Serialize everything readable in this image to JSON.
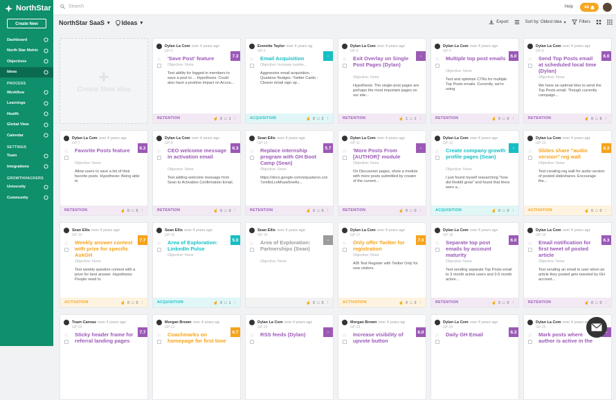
{
  "app": {
    "logo": "NorthStar",
    "create_new": "Create New"
  },
  "nav": [
    {
      "label": "Dashboard",
      "icon": "dashboard-icon",
      "active": false
    },
    {
      "label": "North Star Metric",
      "icon": "target-icon",
      "active": false
    },
    {
      "label": "Objectives",
      "icon": "flag-icon",
      "active": false
    },
    {
      "label": "Ideas",
      "icon": "lightbulb-icon",
      "active": true
    }
  ],
  "sections": {
    "process": "PROCESS",
    "settings": "SETTINGS",
    "growthhackers": "GROWTHHACKERS"
  },
  "process_items": [
    {
      "label": "Workflow"
    },
    {
      "label": "Learnings"
    },
    {
      "label": "Health"
    },
    {
      "label": "Global View"
    },
    {
      "label": "Calendar"
    }
  ],
  "settings_items": [
    {
      "label": "Team"
    },
    {
      "label": "Integrations"
    }
  ],
  "gh_items": [
    {
      "label": "University"
    },
    {
      "label": "Community"
    }
  ],
  "topbar": {
    "search_placeholder": "Search",
    "help": "Help",
    "notif_count": "44"
  },
  "header": {
    "project": "NorthStar SaaS",
    "board": "Ideas",
    "export": "Export",
    "sort": "Sort by: Oldest Idea",
    "filters": "Filters"
  },
  "create_card": {
    "text": "Create New Idea"
  },
  "colors": {
    "retention": "#9b59b6",
    "acquisition": "#16bfc4",
    "activation": "#f5a31a",
    "gray": "#9b9b9b"
  },
  "cards": [
    {
      "author": "Dylan La Com",
      "time": "over 4 years ago",
      "id": "GP-2",
      "score": "7.3",
      "title": "'Save Post' feature",
      "objective": "Objective: None",
      "desc": "Test ability for logged-in members to save a post to ... Hypothesis: Could also have a positive impact on Accou...",
      "category": "RETENTION",
      "color": "#9b59b6",
      "likes": "0",
      "comments": "1"
    },
    {
      "author": "Everette Taylor",
      "time": "over 4 years ago",
      "id": "GP-2",
      "score": "-",
      "title": "Email Acquisition",
      "objective": "Objective: Increase numbe...",
      "desc": "Aggressive email acquisition. -Qualaroo Nudges -Twitter Cards -Clearer email sign up...",
      "category": "ACQUISITION",
      "color": "#16bfc4",
      "likes": "0",
      "comments": "2"
    },
    {
      "author": "Dylan La Com",
      "time": "over 4 years ago",
      "id": "GP-4",
      "score": "-",
      "title": "Exit Overlay on Single Post Pages (Dylan)",
      "objective": "Objective: None",
      "desc": "Hypothesis: The single-post pages are perhaps the most important pages on our site...",
      "category": "RETENTION",
      "color": "#9b59b6",
      "likes": "1",
      "comments": "1"
    },
    {
      "author": "Dylan La Com",
      "time": "over 4 years ago",
      "id": "GP-5",
      "score": "6.0",
      "title": "Multiple top post emails",
      "objective": "Objective: None",
      "desc": "Test and optimize CTRs for multiple Top Posts emails. Currently, we're using",
      "category": "RETENTION",
      "color": "#9b59b6",
      "likes": "0",
      "comments": "0"
    },
    {
      "author": "Dylan La Com",
      "time": "over 4 years ago",
      "id": "GP-6",
      "score": "6.0",
      "title": "Send Top Posts email at scheduled local time (Dylan)",
      "objective": "Objective: None",
      "desc": "We have an optimal time to send the Top Posts email. Though currently campaign...",
      "category": "RETENTION",
      "color": "#9b59b6",
      "likes": "0",
      "comments": "6"
    },
    {
      "author": "Dylan La Com",
      "time": "over 4 years ago",
      "id": "GP-7",
      "score": "6.3",
      "title": "Favorite Posts feature",
      "objective": "Objective: None",
      "desc": "Allow users to save a list of their favorite posts. Hypothesis: Being able to",
      "category": "RETENTION",
      "color": "#9b59b6",
      "likes": "0",
      "comments": "5"
    },
    {
      "author": "Dylan La Com",
      "time": "over 4 years ago",
      "id": "GP-8",
      "score": "6.3",
      "title": "CEO welcome message in activation email",
      "objective": "Objective: None",
      "desc": "Test adding welcome message from Sean to Activation Confirmation Email.",
      "category": "RETENTION",
      "color": "#9b59b6",
      "likes": "0",
      "comments": "0"
    },
    {
      "author": "Sean Ellis",
      "time": "over 4 years ago",
      "id": "GP-10",
      "score": "5.7",
      "title": "Replace internship program with GH Boot Camp (Sean)",
      "objective": "Objective: None",
      "desc": "https://docs.google.com/a/qualaroo.com/document/d/1h-7zm8oLcoMoyw5neAs...",
      "category": "RETENTION",
      "color": "#9b59b6",
      "likes": "0",
      "comments": "0"
    },
    {
      "author": "Dylan La Com",
      "time": "over 4 years ago",
      "id": "GP-11",
      "score": "-",
      "title": "'More Posts From [AUTHOR]' module",
      "objective": "Objective: None",
      "desc": "On Discussion pages, show a module with more posts submitted by creator of the current...",
      "category": "RETENTION",
      "color": "#9b59b6",
      "likes": "0",
      "comments": "0"
    },
    {
      "author": "Dylan La Com",
      "time": "over 4 years ago",
      "id": "GP-12",
      "score": "-",
      "title": "Create company growth profile pages (Sean)",
      "objective": "Objective: None",
      "desc": "I just found myself researching \"how did Reddit grow\" and found that there were a...",
      "category": "ACQUISITION",
      "color": "#16bfc4",
      "likes": "0",
      "comments": "0"
    },
    {
      "author": "Dylan La Com",
      "time": "over 4 years ago",
      "id": "GP-13",
      "score": "6.3",
      "title": "Slides share \"audio version\" reg wall",
      "objective": "Objective: None",
      "desc": "Test creating reg wall for audio version of posted slideshares. Encourage the...",
      "category": "ACTIVATION",
      "color": "#f5a31a",
      "likes": "0",
      "comments": "0"
    },
    {
      "author": "Sean Ellis",
      "time": "over 4 years ago",
      "id": "GP-14",
      "score": "7.7",
      "title": "Weekly answer contest with prize for specific AskGH",
      "objective": "Objective: None",
      "desc": "Test weekly question contest with a prize for best answer. Hypothesis: People need to",
      "category": "ACTIVATION",
      "color": "#f5a31a",
      "likes": "0",
      "comments": "0"
    },
    {
      "author": "Sean Ellis",
      "time": "over 4 years ago",
      "id": "GP-15",
      "score": "5.0",
      "title": "Area of Exploration: LinkedIn Pulse",
      "objective": "Objective: None",
      "desc": "",
      "category": "ACQUISITION",
      "color": "#16bfc4",
      "likes": "0",
      "comments": "1"
    },
    {
      "author": "Sean Ellis",
      "time": "over 4 years ago",
      "id": "GP-16",
      "score": "-",
      "title": "Area of Exploration: Partnerships (Sean)",
      "objective": "Objective: None",
      "desc": "",
      "category": "",
      "color": "#9b9b9b",
      "likes": "0",
      "comments": "0"
    },
    {
      "author": "Dylan La Com",
      "time": "over 4 years ago",
      "id": "GP-17",
      "score": "7.0",
      "title": "Only offer Twitter for registration",
      "objective": "Objective: None",
      "desc": "A/B Test Register with Twitter Only for new visitors.",
      "category": "ACTIVATION",
      "color": "#f5a31a",
      "likes": "0",
      "comments": "3"
    },
    {
      "author": "Dylan La Com",
      "time": "over 4 years ago",
      "id": "GP-18",
      "score": "6.0",
      "title": "Separate top post emails by account maturity",
      "objective": "Objective: None",
      "desc": "Test sending separate Top Posts email to 3 month active users and 3-6 month active...",
      "category": "RETENTION",
      "color": "#9b59b6",
      "likes": "0",
      "comments": "0"
    },
    {
      "author": "Dylan La Com",
      "time": "over 4 years ago",
      "id": "GP-19",
      "score": "6.3",
      "title": "Email notification for first tweet of posted article",
      "objective": "Objective: None",
      "desc": "Test sending an email to user when an article they posted gets tweeted by GH account...",
      "category": "RETENTION",
      "color": "#9b59b6",
      "likes": "0",
      "comments": "0"
    },
    {
      "author": "Team Canvas",
      "time": "over 4 years ago",
      "id": "GP-20",
      "score": "7.7",
      "title": "Sticky header frame for referral landing pages",
      "objective": "",
      "desc": "",
      "category": "",
      "color": "#9b59b6",
      "likes": "",
      "comments": ""
    },
    {
      "author": "Morgan Brown",
      "time": "over 4 years ago",
      "id": "GP-21",
      "score": "6.7",
      "title": "Coachmarks on homepage for first time",
      "objective": "",
      "desc": "",
      "category": "",
      "color": "#f5a31a",
      "likes": "",
      "comments": ""
    },
    {
      "author": "Dylan La Com",
      "time": "over 4 years ago",
      "id": "GP-22",
      "score": "-",
      "title": "RSS feeds (Dylan)",
      "objective": "",
      "desc": "",
      "category": "",
      "color": "#9b59b6",
      "likes": "",
      "comments": ""
    },
    {
      "author": "Morgan Brown",
      "time": "over 4 years ago",
      "id": "GP-23",
      "score": "6.0",
      "title": "Increase visibility of upvote button",
      "objective": "",
      "desc": "",
      "category": "",
      "color": "#9b59b6",
      "likes": "",
      "comments": ""
    },
    {
      "author": "Dylan La Com",
      "time": "over 4 years ago",
      "id": "GP-24",
      "score": "6.3",
      "title": "Daily GH Email",
      "objective": "",
      "desc": "",
      "category": "",
      "color": "#9b59b6",
      "likes": "",
      "comments": ""
    },
    {
      "author": "Dylan La Com",
      "time": "over 4 years ago",
      "id": "GP-25",
      "score": "-",
      "title": "Mark posts where author is active in the",
      "objective": "",
      "desc": "",
      "category": "",
      "color": "#9b59b6",
      "likes": "",
      "comments": ""
    }
  ]
}
